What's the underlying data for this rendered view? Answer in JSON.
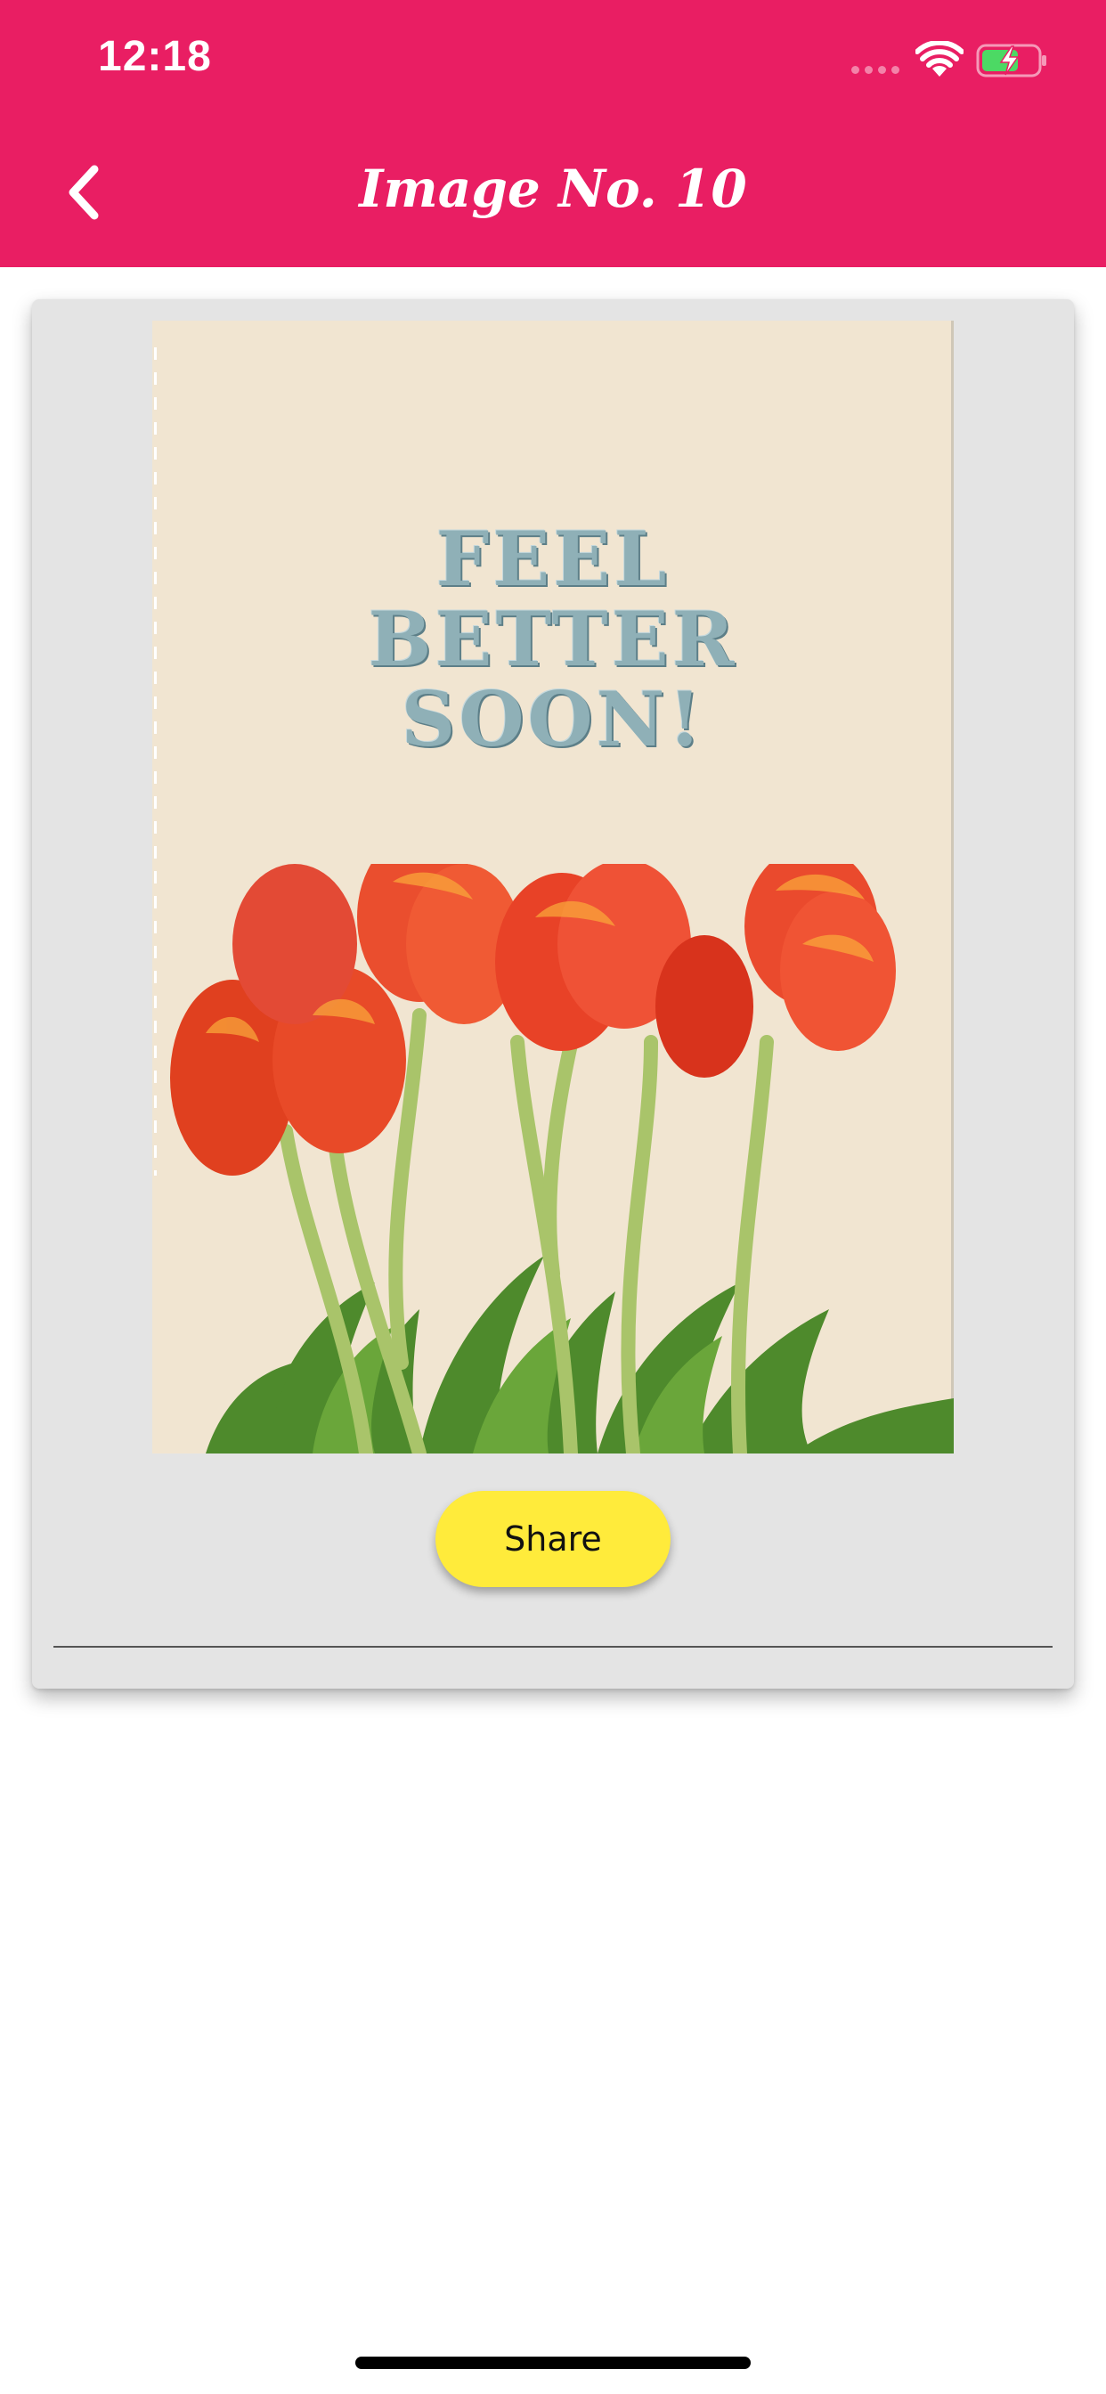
{
  "status_bar": {
    "time": "12:18",
    "signal_icon": "cellular-signal-icon",
    "wifi_icon": "wifi-icon",
    "battery_icon": "battery-charging-icon"
  },
  "header": {
    "title": "Image No. 10",
    "back_icon": "chevron-left-icon",
    "background_color": "#e91e63"
  },
  "card": {
    "image": {
      "alt": "Feel Better Soon card with red tulips",
      "headline": [
        "FEEL",
        "BETTER",
        "SOON!"
      ]
    },
    "share_label": "Share",
    "share_color": "#ffeb3b"
  }
}
